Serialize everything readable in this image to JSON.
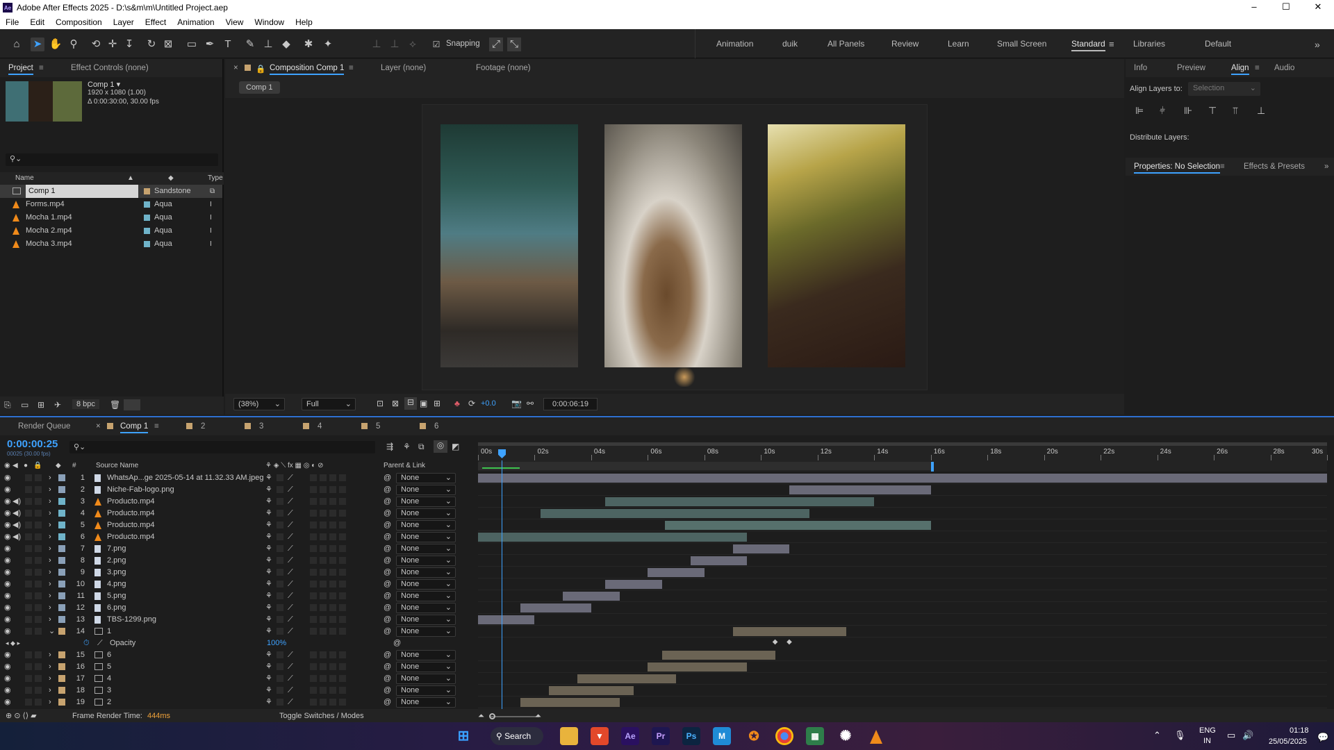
{
  "window": {
    "title": "Adobe After Effects 2025 - D:\\s&m\\m\\Untitled Project.aep",
    "controls": [
      "–",
      "☐",
      "✕"
    ]
  },
  "menu": [
    "File",
    "Edit",
    "Composition",
    "Layer",
    "Effect",
    "Animation",
    "View",
    "Window",
    "Help"
  ],
  "toolbar": {
    "snapping_label": "Snapping",
    "workspaces": [
      "Animation",
      "duik",
      "All Panels",
      "Review",
      "Learn",
      "Small Screen",
      "Standard",
      "Libraries",
      "Default"
    ],
    "active_workspace": "Standard"
  },
  "project_panel": {
    "tabs": [
      "Project",
      "Effect Controls (none)"
    ],
    "comp_info": {
      "name": "Comp 1 ▾",
      "size": "1920 x 1080 (1.00)",
      "duration": "Δ 0:00:30:00, 30.00 fps"
    },
    "columns": [
      "Name",
      "Type"
    ],
    "items": [
      {
        "name": "Comp 1",
        "label": "Sandstone",
        "label_color": "#c7a36f",
        "icon": "composition-icon"
      },
      {
        "name": "Forms.mp4",
        "label": "Aqua",
        "label_color": "#6fb3c9",
        "icon": "vlc-cone-icon"
      },
      {
        "name": "Mocha 1.mp4",
        "label": "Aqua",
        "label_color": "#6fb3c9",
        "icon": "vlc-cone-icon"
      },
      {
        "name": "Mocha 2.mp4",
        "label": "Aqua",
        "label_color": "#6fb3c9",
        "icon": "vlc-cone-icon"
      },
      {
        "name": "Mocha 3.mp4",
        "label": "Aqua",
        "label_color": "#6fb3c9",
        "icon": "vlc-cone-icon"
      }
    ],
    "bpc": "8 bpc"
  },
  "viewer": {
    "tabs": [
      "Composition Comp 1",
      "Layer (none)",
      "Footage (none)"
    ],
    "comp_button": "Comp 1",
    "zoom": "(38%)",
    "resolution": "Full",
    "exposure": "+0.0",
    "timecode": "0:00:06:19"
  },
  "right_panel": {
    "tabs": [
      "Info",
      "Preview",
      "Align",
      "Audio"
    ],
    "align_layers_to_label": "Align Layers to:",
    "align_layers_to_value": "Selection",
    "distribute_label": "Distribute Layers:",
    "lower_tabs": [
      "Properties: No Selection",
      "Effects & Presets"
    ]
  },
  "timeline": {
    "tabs": [
      "Render Queue",
      "Comp 1",
      "2",
      "3",
      "4",
      "5",
      "6"
    ],
    "tab_colors": [
      "#c7a36f",
      "#c7a36f",
      "#c7a36f",
      "#c7a36f",
      "#c7a36f",
      "#c7a36f"
    ],
    "current_time": "0:00:00:25",
    "frame_info": "00025 (30.00 fps)",
    "columns": {
      "source_name": "Source Name",
      "parent": "Parent & Link"
    },
    "ruler": [
      "00s",
      "02s",
      "04s",
      "06s",
      "08s",
      "10s",
      "12s",
      "14s",
      "16s",
      "18s",
      "20s",
      "22s",
      "24s",
      "26s",
      "28s",
      "30s"
    ],
    "parent_value": "None",
    "layers": [
      {
        "num": "1",
        "name": "WhatsAp...ge 2025-05-14 at 11.32.33 AM.jpeg",
        "type": "image",
        "label": "#8aa0b8",
        "audio": false,
        "bar": [
          0,
          30
        ],
        "color": "#6a6a78"
      },
      {
        "num": "2",
        "name": "Niche-Fab-logo.png",
        "type": "image",
        "label": "#8aa0b8",
        "audio": false,
        "bar": [
          11,
          16
        ],
        "color": "#6a6a78"
      },
      {
        "num": "3",
        "name": "Producto.mp4",
        "type": "video",
        "label": "#6fb3c9",
        "audio": true,
        "bar": [
          4.5,
          14
        ],
        "color": "#4d6462"
      },
      {
        "num": "4",
        "name": "Producto.mp4",
        "type": "video",
        "label": "#6fb3c9",
        "audio": true,
        "bar": [
          2.2,
          11.7
        ],
        "color": "#4d6462"
      },
      {
        "num": "5",
        "name": "Producto.mp4",
        "type": "video",
        "label": "#6fb3c9",
        "audio": true,
        "bar": [
          6.6,
          16
        ],
        "color": "#56706c"
      },
      {
        "num": "6",
        "name": "Producto.mp4",
        "type": "video",
        "label": "#6fb3c9",
        "audio": true,
        "bar": [
          0,
          9.5
        ],
        "color": "#4d6462"
      },
      {
        "num": "7",
        "name": "7.png",
        "type": "image",
        "label": "#8aa0b8",
        "audio": false,
        "bar": [
          9,
          11
        ],
        "color": "#6a6a78"
      },
      {
        "num": "8",
        "name": "2.png",
        "type": "image",
        "label": "#8aa0b8",
        "audio": false,
        "bar": [
          7.5,
          9.5
        ],
        "color": "#6a6a78"
      },
      {
        "num": "9",
        "name": "3.png",
        "type": "image",
        "label": "#8aa0b8",
        "audio": false,
        "bar": [
          6,
          8
        ],
        "color": "#6a6a78"
      },
      {
        "num": "10",
        "name": "4.png",
        "type": "image",
        "label": "#8aa0b8",
        "audio": false,
        "bar": [
          4.5,
          6.5
        ],
        "color": "#6a6a78"
      },
      {
        "num": "11",
        "name": "5.png",
        "type": "image",
        "label": "#8aa0b8",
        "audio": false,
        "bar": [
          3,
          5
        ],
        "color": "#6a6a78"
      },
      {
        "num": "12",
        "name": "6.png",
        "type": "image",
        "label": "#8aa0b8",
        "audio": false,
        "bar": [
          1.5,
          4
        ],
        "color": "#6a6a78"
      },
      {
        "num": "13",
        "name": "TBS-1299.png",
        "type": "image",
        "label": "#8aa0b8",
        "audio": false,
        "bar": [
          0,
          2
        ],
        "color": "#6a6a78"
      },
      {
        "num": "14",
        "name": "1",
        "type": "comp",
        "label": "#c7a36f",
        "audio": false,
        "bar": [
          9,
          13
        ],
        "color": "#6b6354",
        "expanded": true
      },
      {
        "num": "15",
        "name": "6",
        "type": "comp",
        "label": "#c7a36f",
        "audio": false,
        "bar": [
          6.5,
          10.5
        ],
        "color": "#6b6354"
      },
      {
        "num": "16",
        "name": "5",
        "type": "comp",
        "label": "#c7a36f",
        "audio": false,
        "bar": [
          6,
          9.5
        ],
        "color": "#6b6354"
      },
      {
        "num": "17",
        "name": "4",
        "type": "comp",
        "label": "#c7a36f",
        "audio": false,
        "bar": [
          3.5,
          7
        ],
        "color": "#6b6354"
      },
      {
        "num": "18",
        "name": "3",
        "type": "comp",
        "label": "#c7a36f",
        "audio": false,
        "bar": [
          2.5,
          5.5
        ],
        "color": "#6b6354"
      },
      {
        "num": "19",
        "name": "2",
        "type": "comp",
        "label": "#c7a36f",
        "audio": false,
        "bar": [
          1.5,
          5
        ],
        "color": "#6b6354"
      }
    ],
    "opacity": {
      "label": "Opacity",
      "value": "100%"
    },
    "footer": {
      "render_time_label": "Frame Render Time:",
      "render_time": "444ms",
      "toggle": "Toggle Switches / Modes"
    }
  },
  "taskbar": {
    "search": "Search",
    "apps": [
      "Ae",
      "Pr",
      "Ps",
      "M"
    ],
    "lang": "ENG",
    "region": "IN",
    "time": "01:18",
    "date": "25/05/2025"
  }
}
